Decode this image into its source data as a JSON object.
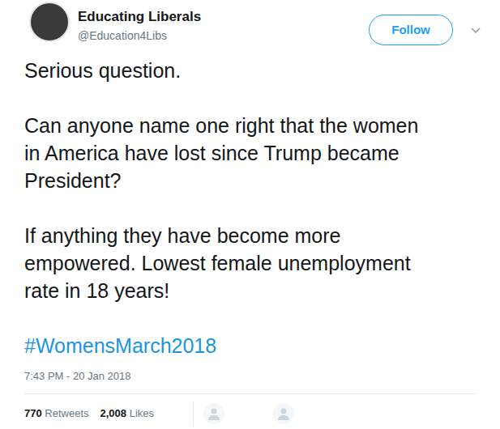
{
  "author": {
    "name": "Educating Liberals",
    "handle": "@Education4Libs"
  },
  "follow_button": {
    "label": "Follow"
  },
  "menu": {
    "expanded": false
  },
  "tweet": {
    "paragraphs": [
      [
        "Serious question."
      ],
      [
        "Can anyone name one right that the women",
        "in America have lost since Trump became",
        "President?"
      ],
      [
        "If anything they have become more",
        "empowered. Lowest female unemployment",
        "rate in 18 years!"
      ]
    ],
    "hashtag": "#WomensMarch2018",
    "timestamp": "7:43 PM - 20 Jan 2018"
  },
  "stats": [
    {
      "count": "770",
      "label": "Retweets"
    },
    {
      "count": "2,008",
      "label": "Likes"
    }
  ],
  "liker_avatars": [
    {
      "placeholder": true
    },
    {
      "placeholder": true
    }
  ]
}
